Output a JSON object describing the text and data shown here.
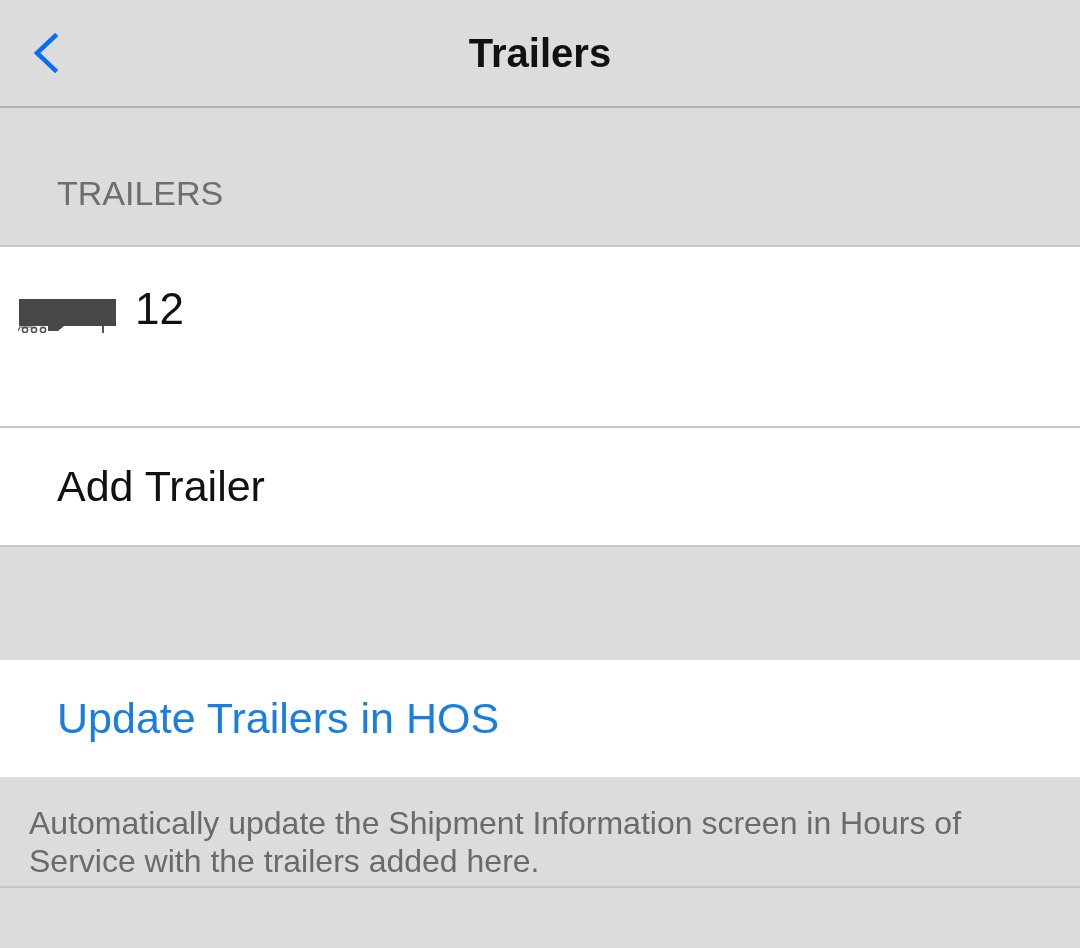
{
  "header": {
    "title": "Trailers"
  },
  "section": {
    "heading": "TRAILERS"
  },
  "trailers": [
    {
      "name": "12"
    }
  ],
  "add_action": {
    "label": "Add Trailer"
  },
  "update_action": {
    "label": "Update Trailers in HOS"
  },
  "footer_note": "Automatically update the Shipment Information screen in Hours of Service with the trailers added here."
}
